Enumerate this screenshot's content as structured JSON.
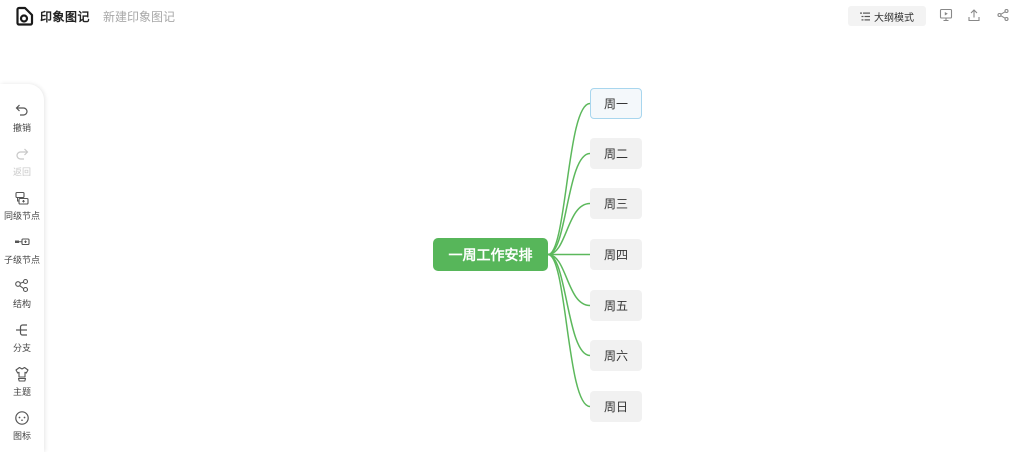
{
  "header": {
    "logo_text": "印象图记",
    "doc_title": "新建印象图记",
    "outline_label": "大纲模式"
  },
  "toolbar": {
    "items": [
      {
        "label": "撤销",
        "icon": "undo-icon",
        "enabled": true
      },
      {
        "label": "返回",
        "icon": "redo-icon",
        "enabled": false
      },
      {
        "label": "同级节点",
        "icon": "sibling-node-icon",
        "enabled": true
      },
      {
        "label": "子级节点",
        "icon": "child-node-icon",
        "enabled": true
      },
      {
        "label": "结构",
        "icon": "structure-icon",
        "enabled": true
      },
      {
        "label": "分支",
        "icon": "branch-icon",
        "enabled": true
      },
      {
        "label": "主题",
        "icon": "theme-icon",
        "enabled": true
      },
      {
        "label": "图标",
        "icon": "emoji-icon",
        "enabled": true
      }
    ]
  },
  "mindmap": {
    "central": "一周工作安排",
    "children": [
      "周一",
      "周二",
      "周三",
      "周四",
      "周五",
      "周六",
      "周日"
    ],
    "selected_index": 0
  },
  "colors": {
    "brand": "#57b65a",
    "branch_line": "#5cb85c",
    "selected_border": "#a8d6ee",
    "node_bg": "#f1f1f1"
  }
}
